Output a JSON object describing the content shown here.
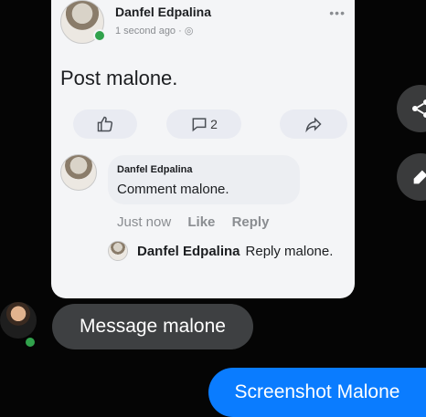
{
  "post": {
    "author": "Danfel Edpalina",
    "meta": "1 second ago · ◎",
    "more_icon": "•••",
    "text": "Post malone.",
    "actions": {
      "like_icon": "thumbs-up-icon",
      "comment_icon": "comment-icon",
      "comment_count": "2",
      "share_icon": "share-arrow-icon"
    }
  },
  "comment": {
    "author": "Danfel Edpalina",
    "text": "Comment malone.",
    "time": "Just now",
    "like_label": "Like",
    "reply_label": "Reply"
  },
  "reply": {
    "author": "Danfel Edpalina",
    "text": "Reply malone."
  },
  "floating": {
    "share_icon": "share-icon",
    "edit_icon": "pencil-icon"
  },
  "messages": [
    {
      "from": "other",
      "text": "Message malone"
    },
    {
      "from": "me",
      "text": "Screenshot Malone"
    }
  ],
  "colors": {
    "background": "#050505",
    "card": "#f4f5f7",
    "incoming_bubble": "#3e4042",
    "outgoing_bubble": "#0a7cff",
    "online": "#31a24c"
  }
}
